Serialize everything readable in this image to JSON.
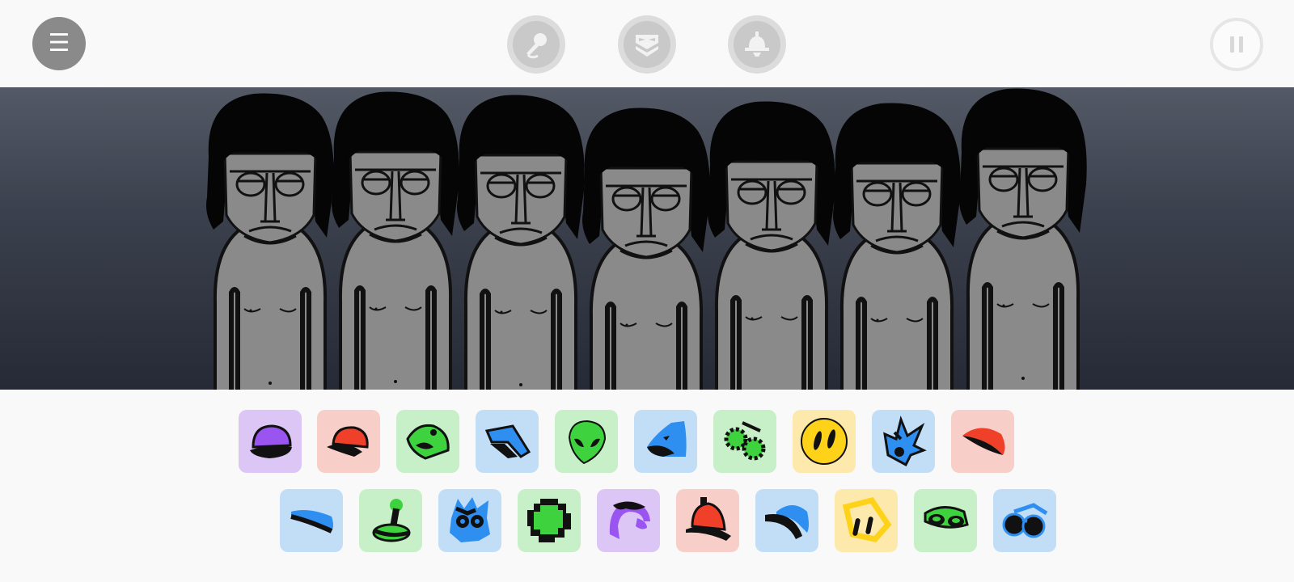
{
  "topbar": {
    "menu_icon": "☰",
    "mode_icons": [
      "microphone-icon",
      "mask-icon",
      "bell-icon"
    ],
    "pause_icon": "pause-icon"
  },
  "stage": {
    "character_count": 7,
    "character_state": "gray-idle",
    "background": "#3c414e"
  },
  "sound_palette": {
    "row1": [
      {
        "icon": "cap-icon",
        "color": "purple"
      },
      {
        "icon": "baseball-cap-icon",
        "color": "red"
      },
      {
        "icon": "frog-hat-icon",
        "color": "green"
      },
      {
        "icon": "visor-glasses-icon",
        "color": "blue"
      },
      {
        "icon": "alien-head-icon",
        "color": "green"
      },
      {
        "icon": "blue-hood-icon",
        "color": "blue"
      },
      {
        "icon": "green-goggles-icon",
        "color": "green"
      },
      {
        "icon": "yellow-eyes-icon",
        "color": "yellow"
      },
      {
        "icon": "spiky-mask-icon",
        "color": "blue"
      },
      {
        "icon": "red-lips-icon",
        "color": "red"
      }
    ],
    "row2": [
      {
        "icon": "headband-icon",
        "color": "blue"
      },
      {
        "icon": "joystick-icon",
        "color": "green"
      },
      {
        "icon": "monster-mask-icon",
        "color": "blue"
      },
      {
        "icon": "pixel-head-icon",
        "color": "green"
      },
      {
        "icon": "purple-hair-icon",
        "color": "purple"
      },
      {
        "icon": "bell-hat-icon",
        "color": "red"
      },
      {
        "icon": "beanie-icon",
        "color": "blue"
      },
      {
        "icon": "yellow-frame-icon",
        "color": "yellow"
      },
      {
        "icon": "green-visor-icon",
        "color": "green"
      },
      {
        "icon": "round-glasses-icon",
        "color": "blue"
      }
    ]
  },
  "colors": {
    "purple": "#dcc6f6",
    "red": "#f8cfc8",
    "green": "#c7efc8",
    "blue": "#c2def7",
    "yellow": "#fde9ab",
    "icon_purple": "#9a55f0",
    "icon_red": "#f0402a",
    "icon_green": "#3fd23f",
    "icon_blue": "#2f8ff0",
    "icon_yellow": "#ffd21a"
  }
}
